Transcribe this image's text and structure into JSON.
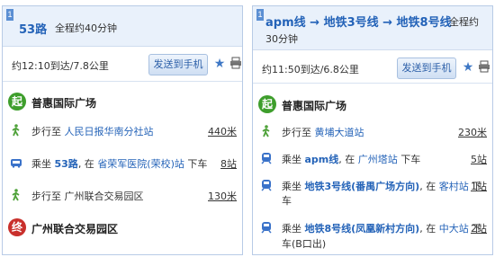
{
  "left": {
    "index": "1",
    "route_title": "53路",
    "total_time": "全程约40分钟",
    "eta_info": "约12:10到达/7.8公里",
    "send_button": "发送到手机",
    "start": {
      "badge": "起",
      "name": "普惠国际广场"
    },
    "steps": [
      {
        "type": "walk",
        "prefix": "步行至",
        "link": "人民日报华南分社站",
        "suffix": "",
        "dist": "440米"
      },
      {
        "type": "bus",
        "prefix": "乘坐",
        "link": "53路",
        "middle": ", 在",
        "link2": "省荣军医院(荣校)站",
        "suffix": "下车",
        "dist": "8站"
      },
      {
        "type": "walk",
        "prefix": "步行至 广州联合交易园区",
        "link": "",
        "suffix": "",
        "dist": "130米"
      }
    ],
    "end": {
      "badge": "终",
      "name": "广州联合交易园区"
    }
  },
  "right": {
    "index": "1",
    "route_title": "apm线 → 地铁3号线 → 地铁8号线",
    "total_time_line1": "全程约",
    "total_time_line2": "30分钟",
    "eta_info": "约11:50到达/6.8公里",
    "send_button": "发送到手机",
    "start": {
      "badge": "起",
      "name": "普惠国际广场"
    },
    "steps": [
      {
        "type": "walk",
        "prefix": "步行至",
        "link": "黄埔大道站",
        "dist": "230米"
      },
      {
        "type": "metro",
        "prefix": "乘坐",
        "link": "apm线",
        "middle": ", 在",
        "link2": "广州塔站",
        "suffix": "下车",
        "dist": "5站"
      },
      {
        "type": "metro",
        "prefix": "乘坐",
        "link": "地铁3号线(番禺广场方向)",
        "middle": ", 在",
        "link2": "客村站",
        "suffix": "下",
        "suffix2": "车",
        "dist": "1站"
      },
      {
        "type": "metro",
        "prefix": "乘坐",
        "link": "地铁8号线(凤凰新村方向)",
        "middle": ", 在",
        "link2": "中大站",
        "suffix": "下",
        "suffix2": "车(B口出)",
        "dist": "2站"
      }
    ]
  }
}
